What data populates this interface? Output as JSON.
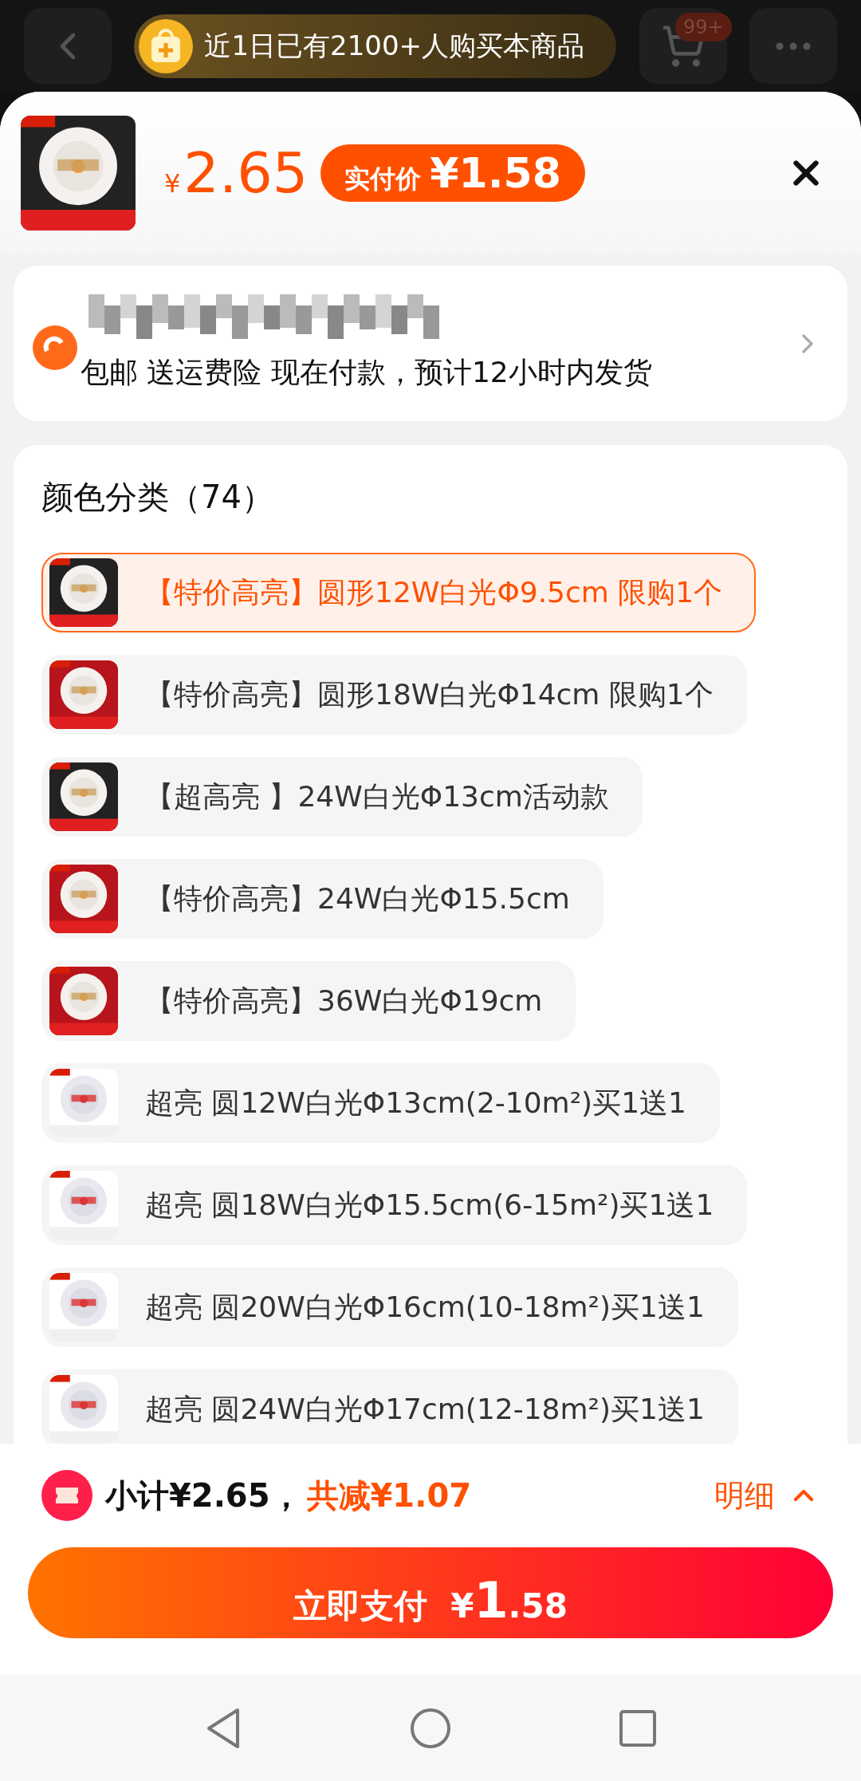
{
  "top_bar": {
    "banner": "近1日已有2100+人购买本商品",
    "cart_badge": "99+"
  },
  "header": {
    "price_currency": "¥",
    "price": "2.65",
    "badge_label": "实付价",
    "badge_amount": "¥1.58"
  },
  "delivery": {
    "text": "包邮 送运费险 现在付款，预计12小时内发货"
  },
  "spec": {
    "title": "颜色分类（74）",
    "options": [
      {
        "label": "【特价高亮】圆形12W白光Φ9.5cm 限购1个",
        "selected": true
      },
      {
        "label": "【特价高亮】圆形18W白光Φ14cm 限购1个",
        "selected": false
      },
      {
        "label": "【超高亮 】24W白光Φ13cm活动款",
        "selected": false
      },
      {
        "label": "【特价高亮】24W白光Φ15.5cm",
        "selected": false
      },
      {
        "label": "【特价高亮】36W白光Φ19cm",
        "selected": false
      },
      {
        "label": "超亮 圆12W白光Φ13cm(2-10m²)买1送1",
        "selected": false
      },
      {
        "label": "超亮 圆18W白光Φ15.5cm(6-15m²)买1送1",
        "selected": false
      },
      {
        "label": "超亮 圆20W白光Φ16cm(10-18m²)买1送1",
        "selected": false
      },
      {
        "label": "超亮 圆24W白光Φ17cm(12-18m²)买1送1",
        "selected": false
      }
    ]
  },
  "footer": {
    "subtotal": "小计¥2.65，",
    "discount": "共减¥1.07",
    "details": "明细",
    "pay_button": {
      "label": "立即支付",
      "currency": "¥",
      "integer": "1",
      "fraction": ".58"
    }
  }
}
